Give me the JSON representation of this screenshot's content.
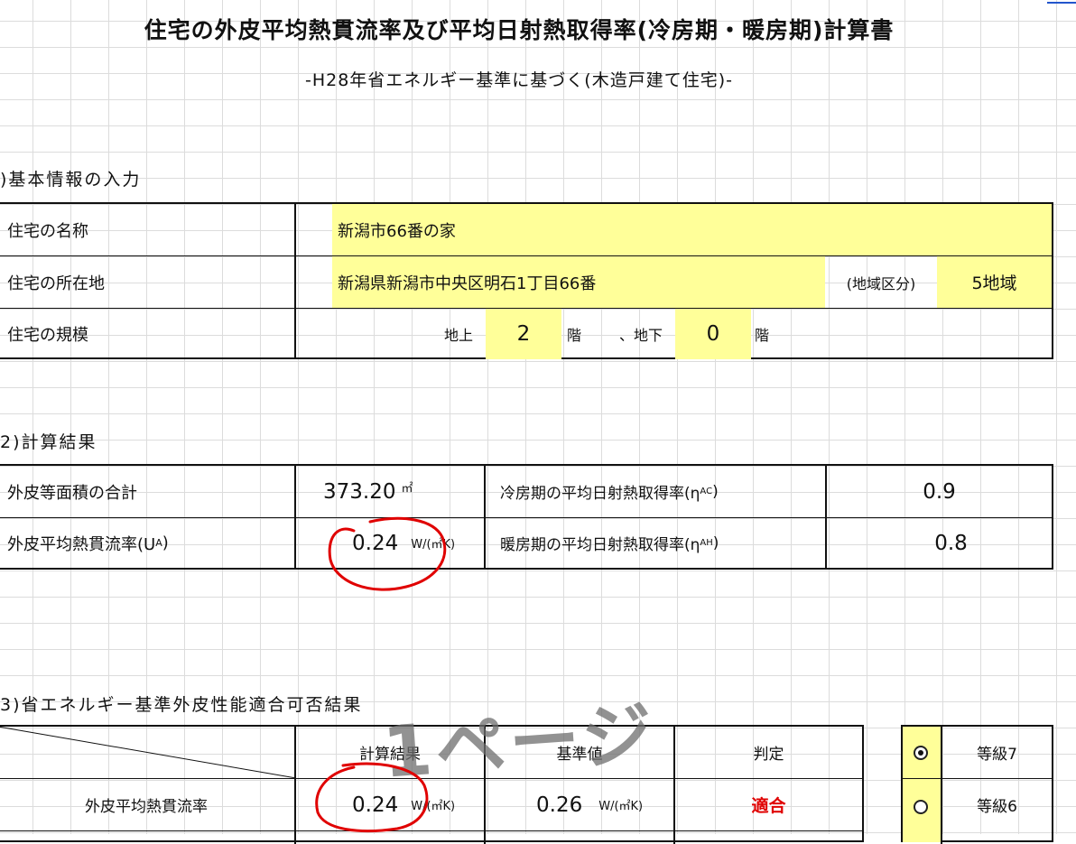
{
  "title": "住宅の外皮平均熱貫流率及び平均日射熱取得率(冷房期・暖房期)計算書",
  "subtitle": "-H28年省エネルギー基準に基づく(木造戸建て住宅)-",
  "section1": {
    "heading": ")基本情報の入力",
    "name_label": "住宅の名称",
    "name_value": "新潟市66番の家",
    "location_label": "住宅の所在地",
    "location_value": "新潟県新潟市中央区明石1丁目66番",
    "region_label": "(地域区分)",
    "region_value": "5地域",
    "scale_label": "住宅の規模",
    "above_label": "地上",
    "above_value": "2",
    "floor_unit1": "階",
    "below_label": "、地下",
    "below_value": "0",
    "floor_unit2": "階"
  },
  "section2": {
    "heading": "2)計算結果",
    "area_label": "外皮等面積の合計",
    "area_value": "373.20",
    "area_unit": "㎡",
    "ua_label_prefix": "外皮平均熱貫流率(U",
    "ua_label_sub": "A",
    "ua_label_suffix": ")",
    "ua_value": "0.24",
    "ua_unit": "W/(㎡K)",
    "etac_label_prefix": "冷房期の平均日射熱取得率(η",
    "etac_label_sub": "AC",
    "etac_label_suffix": ")",
    "etac_value": "0.9",
    "etah_label_prefix": "暖房期の平均日射熱取得率(η",
    "etah_label_sub": "AH",
    "etah_label_suffix": ")",
    "etah_value": "0.8"
  },
  "section3": {
    "heading": "3)省エネルギー基準外皮性能適合可否結果",
    "col_calc": "計算結果",
    "col_standard": "基準値",
    "col_judge": "判定",
    "row_label": "外皮平均熱貫流率",
    "row_calc_value": "0.24",
    "row_calc_unit": "W/(㎡K)",
    "row_std_value": "0.26",
    "row_std_unit": "W/(㎡K)",
    "row_judge": "適合",
    "grade1": "等級7",
    "grade2": "等級6"
  },
  "watermark": "1ページ",
  "colors": {
    "highlight": "#ffff99",
    "pass": "#e00000",
    "annotation": "#e00000"
  }
}
